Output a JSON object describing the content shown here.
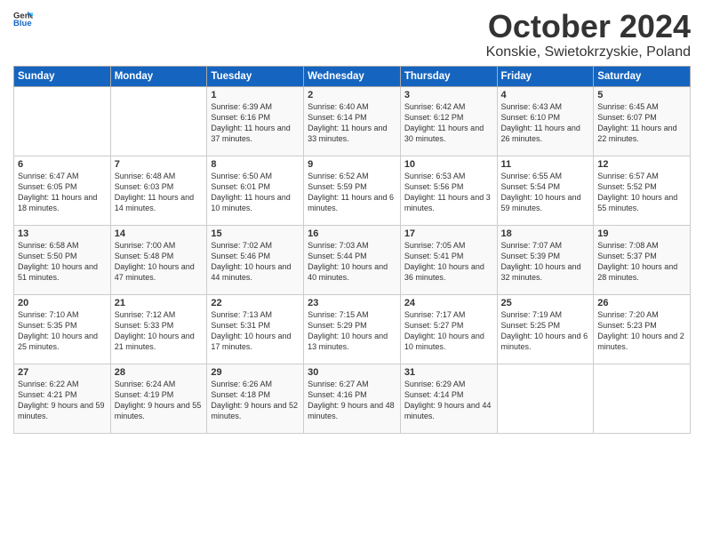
{
  "header": {
    "logo_general": "General",
    "logo_blue": "Blue",
    "title": "October 2024",
    "subtitle": "Konskie, Swietokrzyskie, Poland"
  },
  "weekdays": [
    "Sunday",
    "Monday",
    "Tuesday",
    "Wednesday",
    "Thursday",
    "Friday",
    "Saturday"
  ],
  "weeks": [
    [
      {
        "day": "",
        "sunrise": "",
        "sunset": "",
        "daylight": ""
      },
      {
        "day": "",
        "sunrise": "",
        "sunset": "",
        "daylight": ""
      },
      {
        "day": "1",
        "sunrise": "Sunrise: 6:39 AM",
        "sunset": "Sunset: 6:16 PM",
        "daylight": "Daylight: 11 hours and 37 minutes."
      },
      {
        "day": "2",
        "sunrise": "Sunrise: 6:40 AM",
        "sunset": "Sunset: 6:14 PM",
        "daylight": "Daylight: 11 hours and 33 minutes."
      },
      {
        "day": "3",
        "sunrise": "Sunrise: 6:42 AM",
        "sunset": "Sunset: 6:12 PM",
        "daylight": "Daylight: 11 hours and 30 minutes."
      },
      {
        "day": "4",
        "sunrise": "Sunrise: 6:43 AM",
        "sunset": "Sunset: 6:10 PM",
        "daylight": "Daylight: 11 hours and 26 minutes."
      },
      {
        "day": "5",
        "sunrise": "Sunrise: 6:45 AM",
        "sunset": "Sunset: 6:07 PM",
        "daylight": "Daylight: 11 hours and 22 minutes."
      }
    ],
    [
      {
        "day": "6",
        "sunrise": "Sunrise: 6:47 AM",
        "sunset": "Sunset: 6:05 PM",
        "daylight": "Daylight: 11 hours and 18 minutes."
      },
      {
        "day": "7",
        "sunrise": "Sunrise: 6:48 AM",
        "sunset": "Sunset: 6:03 PM",
        "daylight": "Daylight: 11 hours and 14 minutes."
      },
      {
        "day": "8",
        "sunrise": "Sunrise: 6:50 AM",
        "sunset": "Sunset: 6:01 PM",
        "daylight": "Daylight: 11 hours and 10 minutes."
      },
      {
        "day": "9",
        "sunrise": "Sunrise: 6:52 AM",
        "sunset": "Sunset: 5:59 PM",
        "daylight": "Daylight: 11 hours and 6 minutes."
      },
      {
        "day": "10",
        "sunrise": "Sunrise: 6:53 AM",
        "sunset": "Sunset: 5:56 PM",
        "daylight": "Daylight: 11 hours and 3 minutes."
      },
      {
        "day": "11",
        "sunrise": "Sunrise: 6:55 AM",
        "sunset": "Sunset: 5:54 PM",
        "daylight": "Daylight: 10 hours and 59 minutes."
      },
      {
        "day": "12",
        "sunrise": "Sunrise: 6:57 AM",
        "sunset": "Sunset: 5:52 PM",
        "daylight": "Daylight: 10 hours and 55 minutes."
      }
    ],
    [
      {
        "day": "13",
        "sunrise": "Sunrise: 6:58 AM",
        "sunset": "Sunset: 5:50 PM",
        "daylight": "Daylight: 10 hours and 51 minutes."
      },
      {
        "day": "14",
        "sunrise": "Sunrise: 7:00 AM",
        "sunset": "Sunset: 5:48 PM",
        "daylight": "Daylight: 10 hours and 47 minutes."
      },
      {
        "day": "15",
        "sunrise": "Sunrise: 7:02 AM",
        "sunset": "Sunset: 5:46 PM",
        "daylight": "Daylight: 10 hours and 44 minutes."
      },
      {
        "day": "16",
        "sunrise": "Sunrise: 7:03 AM",
        "sunset": "Sunset: 5:44 PM",
        "daylight": "Daylight: 10 hours and 40 minutes."
      },
      {
        "day": "17",
        "sunrise": "Sunrise: 7:05 AM",
        "sunset": "Sunset: 5:41 PM",
        "daylight": "Daylight: 10 hours and 36 minutes."
      },
      {
        "day": "18",
        "sunrise": "Sunrise: 7:07 AM",
        "sunset": "Sunset: 5:39 PM",
        "daylight": "Daylight: 10 hours and 32 minutes."
      },
      {
        "day": "19",
        "sunrise": "Sunrise: 7:08 AM",
        "sunset": "Sunset: 5:37 PM",
        "daylight": "Daylight: 10 hours and 28 minutes."
      }
    ],
    [
      {
        "day": "20",
        "sunrise": "Sunrise: 7:10 AM",
        "sunset": "Sunset: 5:35 PM",
        "daylight": "Daylight: 10 hours and 25 minutes."
      },
      {
        "day": "21",
        "sunrise": "Sunrise: 7:12 AM",
        "sunset": "Sunset: 5:33 PM",
        "daylight": "Daylight: 10 hours and 21 minutes."
      },
      {
        "day": "22",
        "sunrise": "Sunrise: 7:13 AM",
        "sunset": "Sunset: 5:31 PM",
        "daylight": "Daylight: 10 hours and 17 minutes."
      },
      {
        "day": "23",
        "sunrise": "Sunrise: 7:15 AM",
        "sunset": "Sunset: 5:29 PM",
        "daylight": "Daylight: 10 hours and 13 minutes."
      },
      {
        "day": "24",
        "sunrise": "Sunrise: 7:17 AM",
        "sunset": "Sunset: 5:27 PM",
        "daylight": "Daylight: 10 hours and 10 minutes."
      },
      {
        "day": "25",
        "sunrise": "Sunrise: 7:19 AM",
        "sunset": "Sunset: 5:25 PM",
        "daylight": "Daylight: 10 hours and 6 minutes."
      },
      {
        "day": "26",
        "sunrise": "Sunrise: 7:20 AM",
        "sunset": "Sunset: 5:23 PM",
        "daylight": "Daylight: 10 hours and 2 minutes."
      }
    ],
    [
      {
        "day": "27",
        "sunrise": "Sunrise: 6:22 AM",
        "sunset": "Sunset: 4:21 PM",
        "daylight": "Daylight: 9 hours and 59 minutes."
      },
      {
        "day": "28",
        "sunrise": "Sunrise: 6:24 AM",
        "sunset": "Sunset: 4:19 PM",
        "daylight": "Daylight: 9 hours and 55 minutes."
      },
      {
        "day": "29",
        "sunrise": "Sunrise: 6:26 AM",
        "sunset": "Sunset: 4:18 PM",
        "daylight": "Daylight: 9 hours and 52 minutes."
      },
      {
        "day": "30",
        "sunrise": "Sunrise: 6:27 AM",
        "sunset": "Sunset: 4:16 PM",
        "daylight": "Daylight: 9 hours and 48 minutes."
      },
      {
        "day": "31",
        "sunrise": "Sunrise: 6:29 AM",
        "sunset": "Sunset: 4:14 PM",
        "daylight": "Daylight: 9 hours and 44 minutes."
      },
      {
        "day": "",
        "sunrise": "",
        "sunset": "",
        "daylight": ""
      },
      {
        "day": "",
        "sunrise": "",
        "sunset": "",
        "daylight": ""
      }
    ]
  ]
}
